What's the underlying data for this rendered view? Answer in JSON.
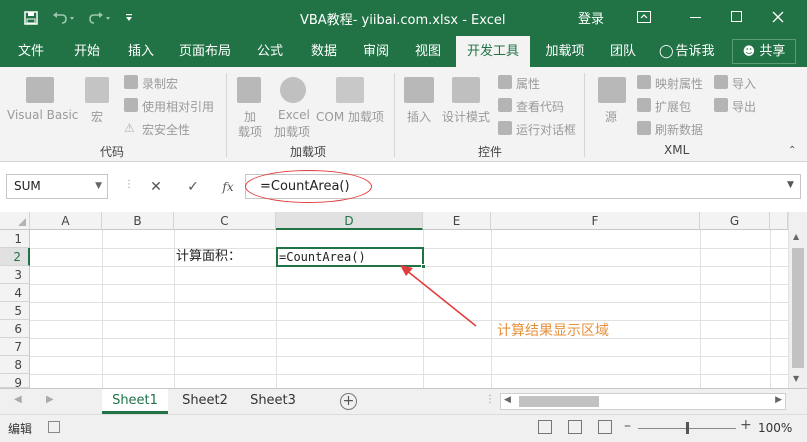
{
  "window": {
    "title": "VBA教程- yiibai.com.xlsx  -  Excel",
    "login_label": "登录",
    "accent_color": "#217346"
  },
  "tabs": [
    {
      "label": "文件"
    },
    {
      "label": "开始"
    },
    {
      "label": "插入"
    },
    {
      "label": "页面布局"
    },
    {
      "label": "公式"
    },
    {
      "label": "数据"
    },
    {
      "label": "审阅"
    },
    {
      "label": "视图"
    },
    {
      "label": "开发工具",
      "active": true
    },
    {
      "label": "加载项"
    },
    {
      "label": "团队"
    },
    {
      "label": "告诉我"
    }
  ],
  "share_label": "共享",
  "ribbon": {
    "code": {
      "label": "代码",
      "visual_basic": "Visual Basic",
      "macros": "宏",
      "record_macro": "录制宏",
      "relative_ref": "使用相对引用",
      "macro_security": "宏安全性"
    },
    "addins": {
      "label": "加载项",
      "addins_line1": "加",
      "addins_line2": "载项",
      "excel_addins_line1": "Excel",
      "excel_addins_line2": "加载项",
      "com_addins": "COM 加载项"
    },
    "controls": {
      "label": "控件",
      "insert": "插入",
      "design_mode": "设计模式",
      "properties": "属性",
      "view_code": "查看代码",
      "run_dialog": "运行对话框"
    },
    "xml": {
      "label": "XML",
      "source": "源",
      "map_properties": "映射属性",
      "expansion_packs": "扩展包",
      "refresh_data": "刷新数据",
      "import": "导入",
      "export": "导出"
    }
  },
  "formula_bar": {
    "name_box": "SUM",
    "fx_label": "fx",
    "formula": "=CountArea()"
  },
  "grid": {
    "columns": [
      "A",
      "B",
      "C",
      "D",
      "E",
      "F",
      "G"
    ],
    "rows": [
      "1",
      "2",
      "3",
      "4",
      "5",
      "6",
      "7",
      "8",
      "9"
    ],
    "cell_c2": "计算面积：",
    "cell_d2": "=CountArea()"
  },
  "annotation": {
    "text": "计算结果显示区域",
    "color": "#e8903c",
    "ellipse_color": "#e23b3b"
  },
  "sheets": [
    {
      "label": "Sheet1",
      "active": true
    },
    {
      "label": "Sheet2"
    },
    {
      "label": "Sheet3"
    }
  ],
  "status": {
    "mode": "编辑",
    "zoom": "100%"
  }
}
